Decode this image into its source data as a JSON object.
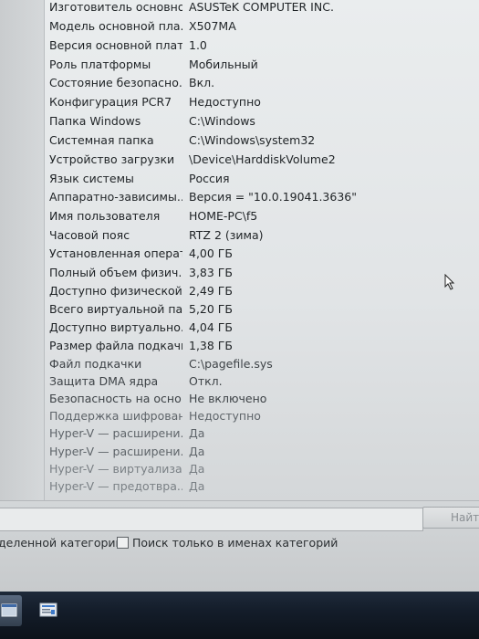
{
  "system_summary": {
    "rows": [
      {
        "name": "Изготовитель основно...",
        "value": "ASUSTeK COMPUTER INC."
      },
      {
        "name": "Модель основной пла...",
        "value": "X507MA"
      },
      {
        "name": "Версия основной платы",
        "value": "1.0"
      },
      {
        "name": "Роль платформы",
        "value": "Мобильный"
      },
      {
        "name": "Состояние безопасно...",
        "value": "Вкл."
      },
      {
        "name": "Конфигурация PCR7",
        "value": "Недоступно"
      },
      {
        "name": "Папка Windows",
        "value": "C:\\Windows"
      },
      {
        "name": "Системная папка",
        "value": "C:\\Windows\\system32"
      },
      {
        "name": "Устройство загрузки",
        "value": "\\Device\\HarddiskVolume2"
      },
      {
        "name": "Язык системы",
        "value": "Россия"
      },
      {
        "name": "Аппаратно-зависимы...",
        "value": "Версия = \"10.0.19041.3636\""
      },
      {
        "name": "Имя пользователя",
        "value": "HOME-PC\\f5"
      },
      {
        "name": "Часовой пояс",
        "value": "RTZ 2 (зима)"
      },
      {
        "name": "Установленная операт...",
        "value": "4,00 ГБ"
      },
      {
        "name": "Полный объем физич...",
        "value": "3,83 ГБ"
      },
      {
        "name": "Доступно физической ...",
        "value": "2,49 ГБ"
      },
      {
        "name": "Всего виртуальной па...",
        "value": "5,20 ГБ"
      },
      {
        "name": "Доступно виртуально...",
        "value": "4,04 ГБ"
      },
      {
        "name": "Размер файла подкачки",
        "value": "1,38 ГБ"
      },
      {
        "name": "Файл подкачки",
        "value": "C:\\pagefile.sys"
      },
      {
        "name": "Защита DMA ядра",
        "value": "Откл."
      },
      {
        "name": "Безопасность на осно...",
        "value": "Не включено"
      },
      {
        "name": "Поддержка шифрован...",
        "value": "Недоступно"
      },
      {
        "name": "Hyper-V — расширени...",
        "value": "Да"
      },
      {
        "name": "Hyper-V — расширени...",
        "value": "Да"
      },
      {
        "name": "Hyper-V — виртуализа...",
        "value": "Да"
      },
      {
        "name": "Hyper-V — предотвра...",
        "value": "Да"
      }
    ]
  },
  "search": {
    "input_value": "",
    "find_button_label": "Найти",
    "option_selected_category_label": "деленной категории",
    "option_names_only_label": "Поиск только в именах категорий"
  },
  "taskbar": {
    "items": [
      {
        "icon": "window-icon"
      },
      {
        "icon": "system-info-icon"
      }
    ]
  },
  "colors": {
    "taskbar": "#141d2a",
    "list_background": "#e3e6e8",
    "text": "#1f2326"
  }
}
